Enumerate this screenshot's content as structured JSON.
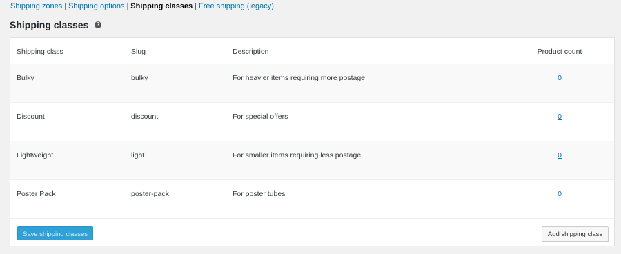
{
  "subnav": {
    "items": [
      {
        "label": "Shipping zones"
      },
      {
        "label": "Shipping options"
      },
      {
        "label": "Shipping classes"
      },
      {
        "label": "Free shipping (legacy)"
      }
    ],
    "separator": "|",
    "current_index": 2
  },
  "page": {
    "title": "Shipping classes",
    "help_icon": "question-circle-icon",
    "help_glyph": "?"
  },
  "table": {
    "headers": {
      "shipping_class": "Shipping class",
      "slug": "Slug",
      "description": "Description",
      "product_count": "Product count"
    },
    "rows": [
      {
        "name": "Bulky",
        "slug": "bulky",
        "description": "For heavier items requiring more postage",
        "count": "0"
      },
      {
        "name": "Discount",
        "slug": "discount",
        "description": "For special offers",
        "count": "0"
      },
      {
        "name": "Lightweight",
        "slug": "light",
        "description": "For smaller items requiring less postage",
        "count": "0"
      },
      {
        "name": "Poster Pack",
        "slug": "poster-pack",
        "description": "For poster tubes",
        "count": "0"
      }
    ]
  },
  "footer": {
    "save_label": "Save shipping classes",
    "add_label": "Add shipping class"
  },
  "colors": {
    "link": "#0073aa",
    "primary_button": "#32a0d4",
    "background": "#f1f1f1"
  }
}
